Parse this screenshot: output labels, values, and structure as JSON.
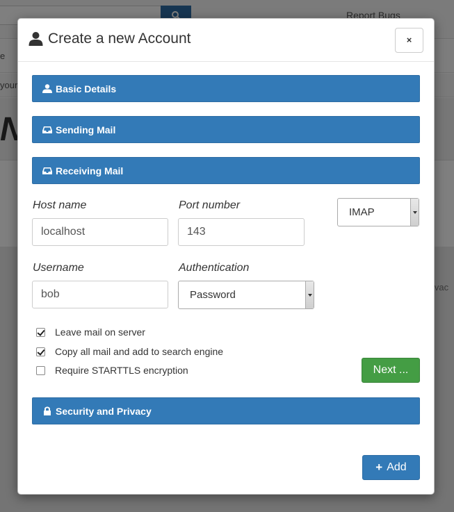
{
  "background": {
    "report_link": "Report Bugs",
    "row1_text": "e",
    "row2_text": "your",
    "hero_text": "Ne",
    "side_text": "ivac"
  },
  "modal": {
    "title": "Create a new Account",
    "close_label": "×",
    "sections": {
      "basic": "Basic Details",
      "sending": "Sending Mail",
      "receiving": "Receiving Mail",
      "security": "Security and Privacy"
    },
    "form": {
      "host_label": "Host name",
      "host_value": "localhost",
      "port_label": "Port number",
      "port_value": "143",
      "protocol_value": "IMAP",
      "username_label": "Username",
      "username_value": "bob",
      "auth_label": "Authentication",
      "auth_value": "Password"
    },
    "checkboxes": {
      "leave_mail": {
        "label": "Leave mail on server",
        "checked": true
      },
      "copy_mail": {
        "label": "Copy all mail and add to search engine",
        "checked": true
      },
      "starttls": {
        "label": "Require STARTTLS encryption",
        "checked": false
      }
    },
    "next_label": "Next ...",
    "add_label": "Add"
  },
  "colors": {
    "section_bar": "#337ab7",
    "next_button": "#449d44",
    "add_button": "#337ab7"
  }
}
